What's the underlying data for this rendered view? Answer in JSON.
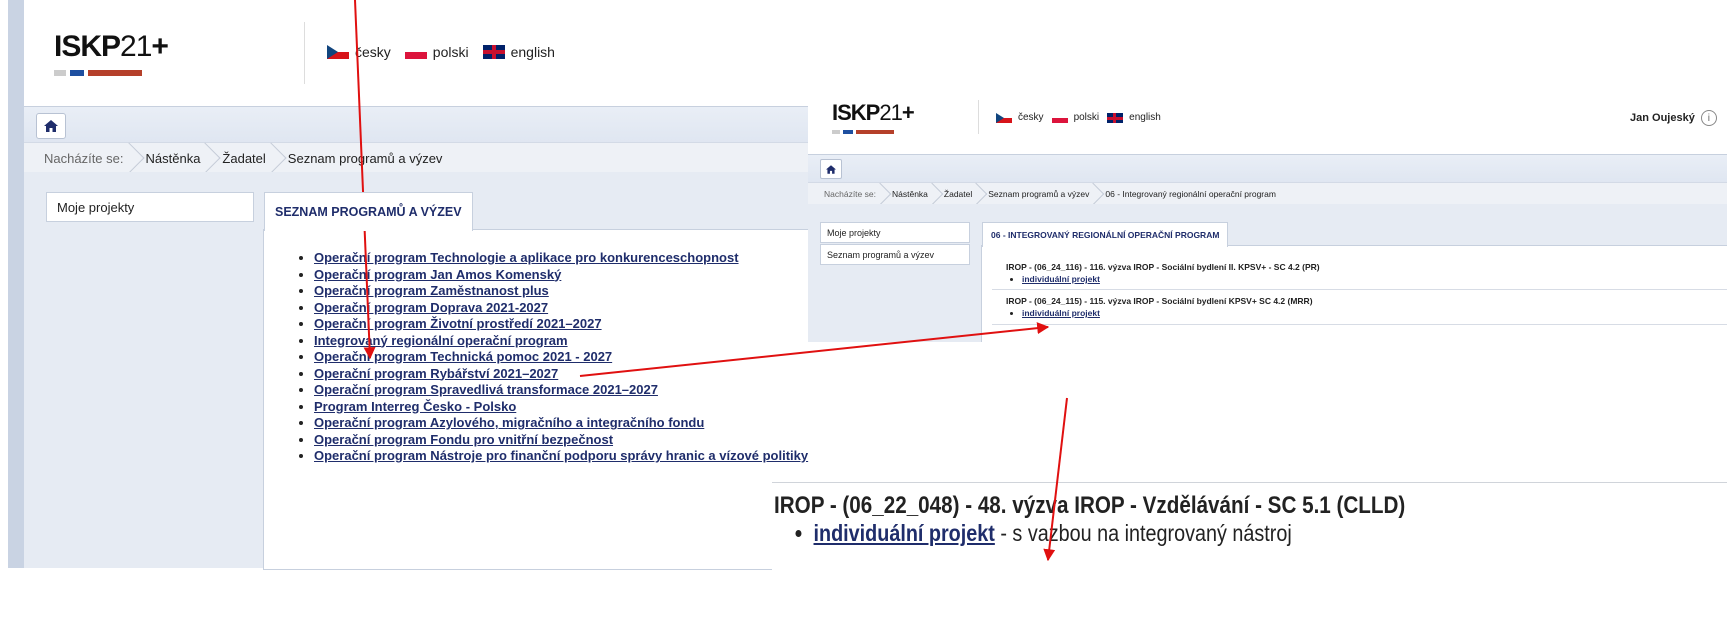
{
  "logo": {
    "text_bold": "ISKP",
    "text_light": "21",
    "plus": "+"
  },
  "languages": [
    {
      "label": "česky",
      "icon": "czech-flag-icon"
    },
    {
      "label": "polski",
      "icon": "polish-flag-icon"
    },
    {
      "label": "english",
      "icon": "uk-flag-icon"
    }
  ],
  "breadcrumb": {
    "prefix": "Nacházíte se:",
    "items": [
      "Nástěnka",
      "Žadatel",
      "Seznam programů a výzev"
    ]
  },
  "sidebar": {
    "items": [
      "Moje projekty"
    ]
  },
  "main": {
    "tab_label": "SEZNAM PROGRAMŮ A VÝZEV",
    "programs": [
      "Operační program Technologie a aplikace pro konkurenceschopnost",
      "Operační program Jan Amos Komenský",
      "Operační program Zaměstnanost plus",
      "Operační program Doprava 2021-2027",
      "Operační program Životní prostředí 2021–2027",
      "Integrovaný regionální operační program",
      "Operační program Technická pomoc 2021 - 2027",
      "Operační program Rybářství 2021–2027",
      "Operační program Spravedlivá transformace 2021–2027",
      "Program Interreg Česko - Polsko",
      "Operační program Azylového, migračního a integračního fondu",
      "Operační program Fondu pro vnitřní bezpečnost",
      "Operační program Nástroje pro finanční podporu správy hranic a vízové politiky"
    ]
  },
  "inset": {
    "user_name": "Jan Oujeský",
    "breadcrumb": {
      "prefix": "Nacházíte se:",
      "items": [
        "Nástěnka",
        "Žadatel",
        "Seznam programů a výzev",
        "06 - Integrovaný regionální operační program"
      ]
    },
    "sidebar": [
      "Moje projekty",
      "Seznam programů a výzev"
    ],
    "tab_label": "06 - INTEGROVANÝ REGIONÁLNÍ OPERAČNÍ PROGRAM",
    "calls": [
      {
        "title": "IROP - (06_24_116) - 116. výzva IROP - Sociální bydlení II. KPSV+ - SC 4.2 (PR)",
        "link": "individuální projekt"
      },
      {
        "title": "IROP - (06_24_115) - 115. výzva IROP - Sociální bydlení KPSV+ SC 4.2 (MRR)",
        "link": "individuální projekt"
      }
    ]
  },
  "zoom": {
    "title": "IROP - (06_22_048) - 48. výzva IROP - Vzdělávání - SC 5.1 (CLLD)",
    "link": "individuální projekt",
    "suffix": " - s vazbou na integrovaný nástroj"
  },
  "colors": {
    "link": "#1f2d6b",
    "arrow": "#e01010",
    "accent_red": "#b5402a",
    "accent_blue": "#1e4fa0"
  }
}
